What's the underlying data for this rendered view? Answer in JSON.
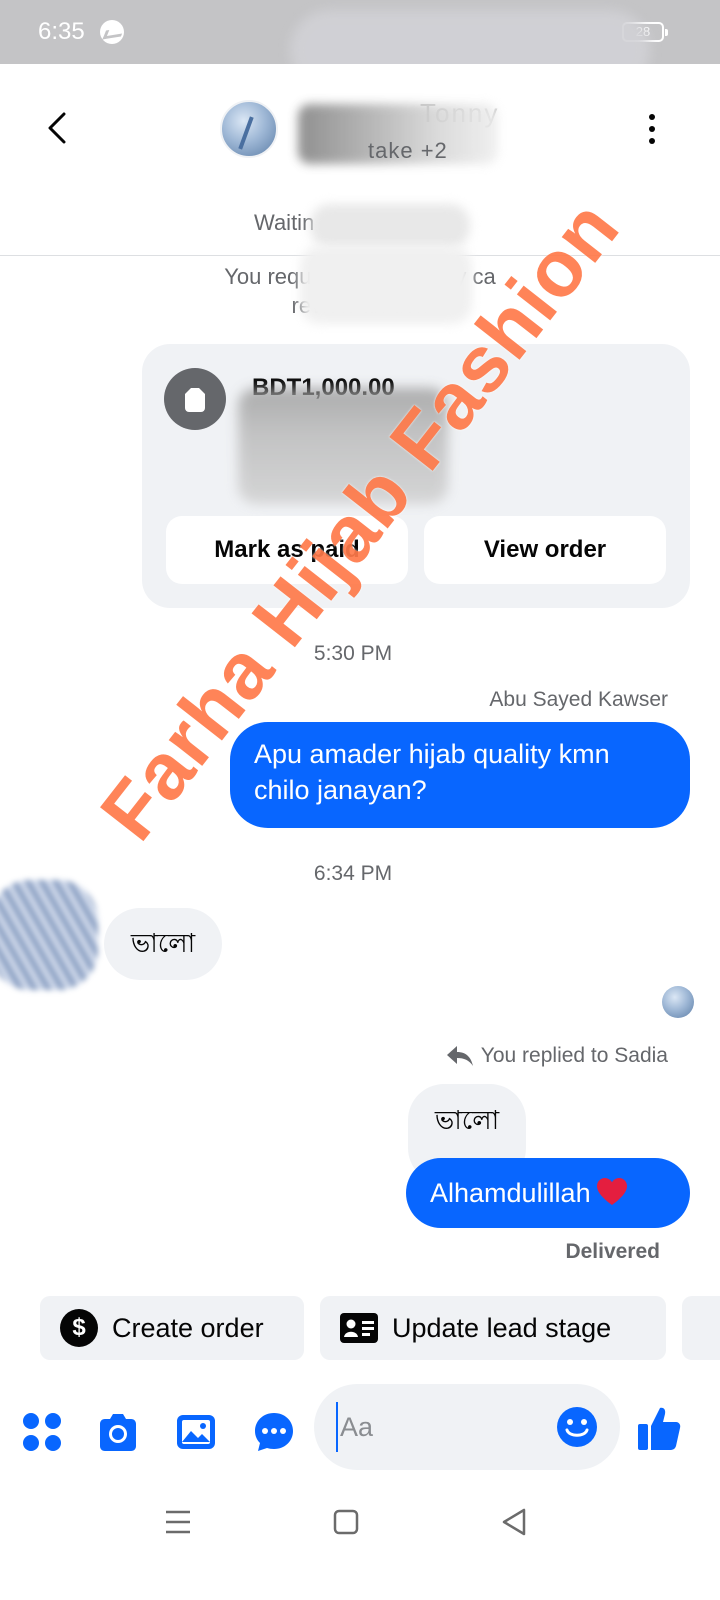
{
  "status_bar": {
    "time": "6:35",
    "battery": "28"
  },
  "header": {
    "contact_name": "Tonny",
    "contact_sub": "take +2",
    "waiting_text": "Waitin"
  },
  "system_message": {
    "line1": "You requested BD                       Tonny ca",
    "line2": "review an                            der."
  },
  "order_card": {
    "amount": "BDT1,000.00",
    "buttons": {
      "mark_paid": "Mark as paid",
      "view_order": "View order"
    }
  },
  "messages": {
    "timestamp_1": "5:30 PM",
    "sender_1": "Abu Sayed Kawser",
    "outgoing_1": "Apu amader hijab quality kmn chilo janayan?",
    "timestamp_2": "6:34 PM",
    "incoming_1": "ভালো",
    "reply_label": "You replied to Sadia",
    "quoted_text": "ভালো",
    "outgoing_2": "Alhamdulillah",
    "delivered": "Delivered"
  },
  "quick_actions": {
    "create_order": "Create order",
    "update_lead_stage": "Update lead stage"
  },
  "composer": {
    "placeholder": "Aa"
  },
  "watermark": "Farha Hijab Fashion",
  "colors": {
    "accent": "#0866ff",
    "bubble_in": "#f0f2f5",
    "watermark": "#ff7a4a",
    "heart": "#e41e3f"
  },
  "icons": [
    "back-arrow-icon",
    "kebab-menu-icon",
    "tag-icon",
    "reply-arrow-icon",
    "heart-icon",
    "dollar-icon",
    "id-card-icon",
    "apps-icon",
    "camera-icon",
    "gallery-icon",
    "chat-bubble-icon",
    "emoji-icon",
    "like-icon",
    "nav-menu-icon",
    "nav-home-icon",
    "nav-back-icon"
  ]
}
